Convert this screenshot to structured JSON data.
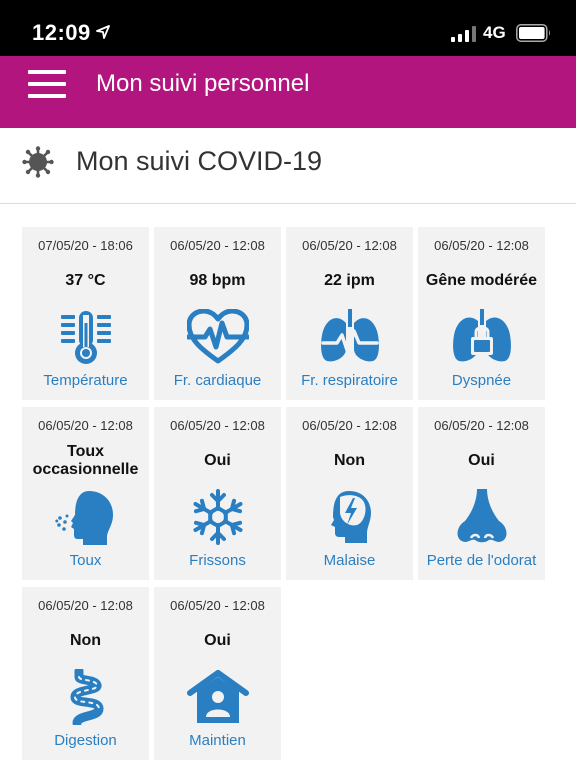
{
  "status": {
    "time": "12:09",
    "network": "4G"
  },
  "header": {
    "title": "Mon suivi personnel"
  },
  "page": {
    "title": "Mon suivi COVID-19"
  },
  "colors": {
    "accent": "#b3157f",
    "icon_blue": "#2a7fc3",
    "card_bg": "#f2f2f2"
  },
  "cards": [
    {
      "date": "07/05/20 - 18:06",
      "value": "37 °C",
      "label": "Température",
      "icon": "thermometer-icon"
    },
    {
      "date": "06/05/20 - 12:08",
      "value": "98 bpm",
      "label": "Fr. cardiaque",
      "icon": "heart-rate-icon"
    },
    {
      "date": "06/05/20 - 12:08",
      "value": "22 ipm",
      "label": "Fr. respiratoire",
      "icon": "lungs-icon"
    },
    {
      "date": "06/05/20 - 12:08",
      "value": "Gêne modérée",
      "label": "Dyspnée",
      "icon": "lungs-lock-icon"
    },
    {
      "date": "06/05/20 - 12:08",
      "value": "Toux occasionnelle",
      "label": "Toux",
      "icon": "cough-icon"
    },
    {
      "date": "06/05/20 - 12:08",
      "value": "Oui",
      "label": "Frissons",
      "icon": "snowflake-icon"
    },
    {
      "date": "06/05/20 - 12:08",
      "value": "Non",
      "label": "Malaise",
      "icon": "head-lightning-icon"
    },
    {
      "date": "06/05/20 - 12:08",
      "value": "Oui",
      "label": "Perte de l'odorat",
      "icon": "nose-icon"
    },
    {
      "date": "06/05/20 - 12:08",
      "value": "Non",
      "label": "Digestion",
      "icon": "intestine-icon"
    },
    {
      "date": "06/05/20 - 12:08",
      "value": "Oui",
      "label": "Maintien",
      "icon": "home-person-icon"
    }
  ]
}
